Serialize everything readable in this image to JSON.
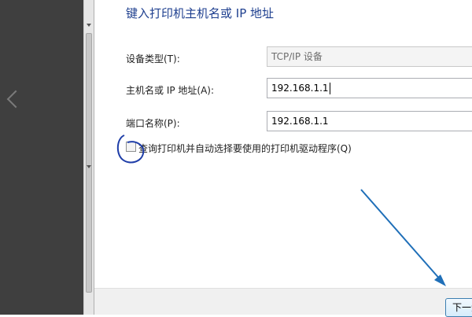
{
  "dialog": {
    "heading": "键入打印机主机名或 IP 地址",
    "device_type": {
      "label": "设备类型(T):",
      "value": "TCP/IP 设备"
    },
    "hostname": {
      "label": "主机名或 IP 地址(A):",
      "value": "192.168.1.1"
    },
    "port_name": {
      "label": "端口名称(P):",
      "value": "192.168.1.1"
    },
    "query_printer": {
      "label": "查询打印机并自动选择要使用的打印机驱动程序(Q)",
      "checked": false
    },
    "next_button": "下一步"
  },
  "annotations": {
    "color": "#1f5fa8"
  }
}
